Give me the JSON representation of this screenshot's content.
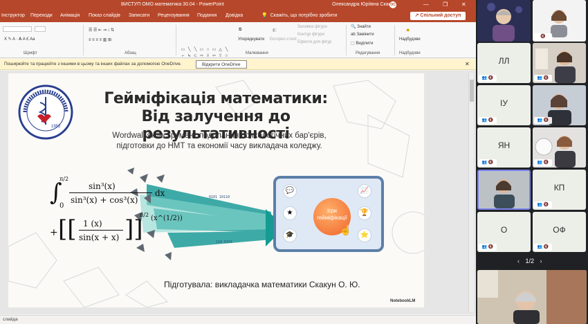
{
  "window": {
    "title": "ВИСТУП ОМО математика  30.04  -  PowerPoint",
    "user": "Олександра Юріївна Скакун",
    "avatar_initials": "ОС",
    "menu_left_partial": "Інструктор",
    "minimize": "—",
    "restore": "❐",
    "close": "✕"
  },
  "menu": {
    "items": [
      "Переходи",
      "Анімація",
      "Показ слайдів",
      "Записати",
      "Рецензування",
      "Подання",
      "Довідка"
    ],
    "tell_me": "Скажіть, що потрібно зробити",
    "share": "Спільний доступ"
  },
  "ribbon": {
    "groups": {
      "font": "Шрифт",
      "paragraph": "Абзац",
      "drawing": "Малювання",
      "editing": "Редагування",
      "addins": "Надбудови"
    },
    "arrange": "Упорядкувати",
    "quick_styles": "Експрес-стилі",
    "fill": "Заливка фігури",
    "outline": "Контур фігури",
    "effects": "Ефекти для фігур",
    "find": "Знайти",
    "replace": "Замінити",
    "select": "Виділити",
    "addins_btn": "Надбудови"
  },
  "notification": {
    "text": "Поширюйте та працюйте з іншими в цьому та інших файлах за допомогою OneDrive.",
    "button": "Відкрити OneDrive",
    "close": "✕"
  },
  "slide": {
    "title_line1": "Гейміфікація математики:",
    "title_line2": "Від залучення до результативності",
    "subtitle_line1": "Wordwall як інструмент подолання психологічних бар'єрів,",
    "subtitle_line2": "підготовки до НМТ та економії часу викладача коледжу.",
    "logo_year": "1952",
    "tablet_button": "Ігри гейміфікації",
    "author": "Підготувала: викладачка математики Скакун О. Ю.",
    "watermark": "NotebookLM",
    "formula": {
      "int_upper": "π/2",
      "int_lower": "0",
      "frac1_num": "sin³(x)",
      "frac1_den": "sin³(x) + cos³(x)",
      "dx": "dx",
      "plus": "+",
      "frac2_num": "1  (x)",
      "frac2_den": "sin(x + x)",
      "pow1": "π/2",
      "pow2": "(x^(1/2))"
    }
  },
  "status": {
    "text": "слайда"
  },
  "participants": [
    {
      "initials": "",
      "kind": "video"
    },
    {
      "initials": "",
      "kind": "video"
    },
    {
      "initials": "ЛЛ",
      "kind": "initials"
    },
    {
      "initials": "",
      "kind": "video"
    },
    {
      "initials": "ІУ",
      "kind": "initials"
    },
    {
      "initials": "",
      "kind": "video"
    },
    {
      "initials": "ЯН",
      "kind": "initials"
    },
    {
      "initials": "",
      "kind": "video"
    },
    {
      "initials": "",
      "kind": "video"
    },
    {
      "initials": "КП",
      "kind": "initials"
    },
    {
      "initials": "О",
      "kind": "initials"
    },
    {
      "initials": "ОФ",
      "kind": "initials"
    },
    {
      "initials": "",
      "kind": "video"
    }
  ],
  "pager": {
    "label": "1/2",
    "prev": "‹",
    "next": "›"
  },
  "colors": {
    "ppt_accent": "#b7472a",
    "slide_bg": "#fbfaf7",
    "tile_initials_bg": "#ecefe8",
    "tablet_button": "#f0642a",
    "selected_tile": "#7b83eb"
  }
}
